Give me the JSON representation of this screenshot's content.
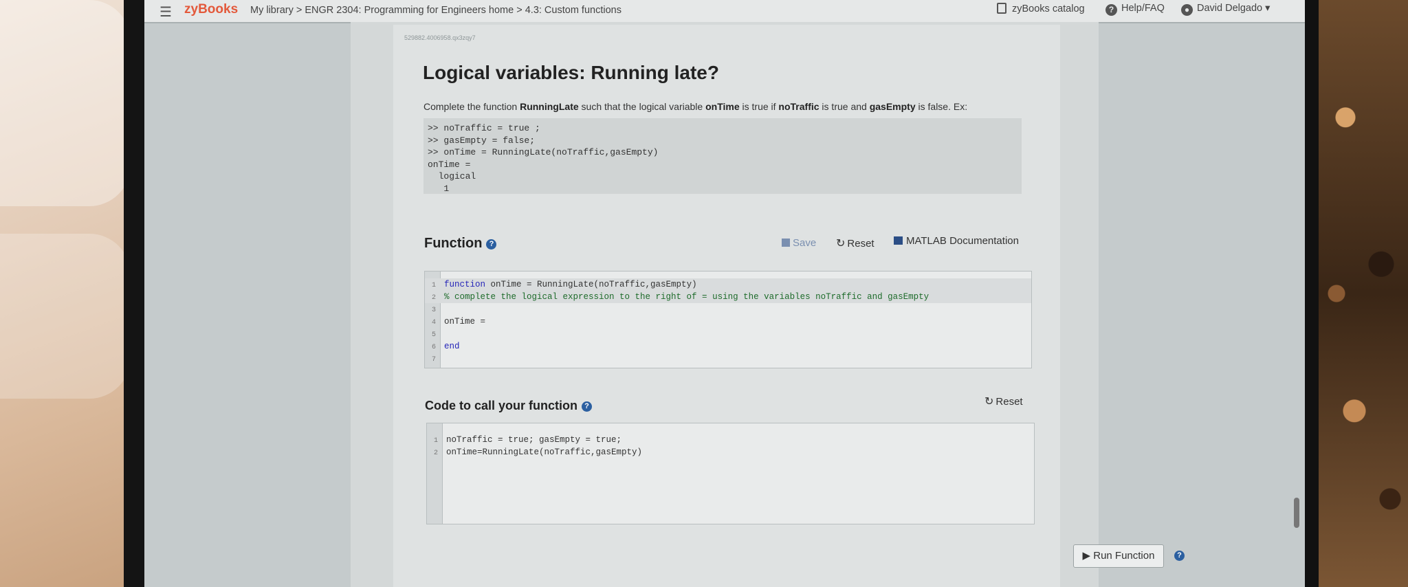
{
  "header": {
    "brand": "zyBooks",
    "breadcrumb": "My library > ENGR 2304: Programming for Engineers home > 4.3: Custom functions",
    "catalog": "zyBooks catalog",
    "help": "Help/FAQ",
    "user": "David Delgado"
  },
  "activity": {
    "id": "529882.4006958.qx3zqy7",
    "title": "Logical variables: Running late?",
    "desc_1": "Complete the function ",
    "desc_func": "RunningLate",
    "desc_2": " such that the logical variable ",
    "desc_var1": "onTime",
    "desc_3": " is true if ",
    "desc_var2": "noTraffic",
    "desc_4": " is true and ",
    "desc_var3": "gasEmpty",
    "desc_5": " is false.  Ex:",
    "example": ">> noTraffic = true ;\n>> gasEmpty = false;\n>> onTime = RunningLate(noTraffic,gasEmpty)\nonTime =\n  logical\n   1"
  },
  "function_section": {
    "title": "Function",
    "save": "Save",
    "reset": "Reset",
    "docs": "MATLAB Documentation",
    "lines": [
      {
        "n": "1",
        "text": ""
      },
      {
        "n": "2",
        "text": "% complete the logical expression to the right of = using the variables noTraffic and gasEmpty"
      },
      {
        "n": "3",
        "text": ""
      },
      {
        "n": "4",
        "text": "onTime = "
      },
      {
        "n": "5",
        "text": ""
      },
      {
        "n": "6",
        "text": ""
      },
      {
        "n": "7",
        "text": ""
      }
    ],
    "line1_kw": "function",
    "line1_rest": " onTime = RunningLate(noTraffic,gasEmpty)",
    "line6_kw": "end"
  },
  "call_section": {
    "title": "Code to call your function",
    "reset": "Reset",
    "lines": [
      {
        "n": "1",
        "text": "noTraffic = true; gasEmpty = true;"
      },
      {
        "n": "2",
        "text": "onTime=RunningLate(noTraffic,gasEmpty)"
      }
    ]
  },
  "run_button": "Run Function",
  "help_icon_char": "?"
}
